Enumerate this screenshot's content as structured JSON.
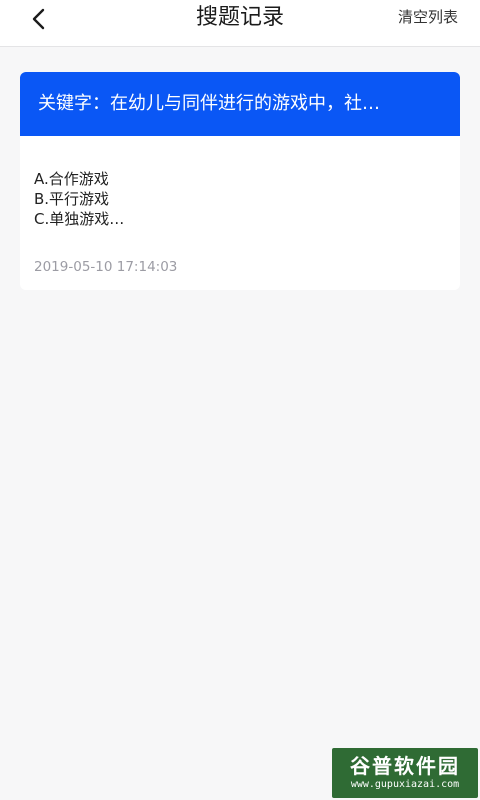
{
  "header": {
    "back_icon": "chevron-left-icon",
    "title": "搜题记录",
    "clear_label": "清空列表"
  },
  "records": [
    {
      "keyword": "关键字：在幼儿与同伴进行的游戏中，社…",
      "options": [
        "A.合作游戏",
        "B.平行游戏",
        "C.单独游戏…"
      ],
      "time": "2019-05-10 17:14:03"
    }
  ],
  "watermark": {
    "logo_text": "谷普软件园",
    "url": "www.gupuxiazai.com"
  },
  "colors": {
    "accent": "#0a57f5",
    "background": "#f7f7f8",
    "timestamp": "#9c9ca4",
    "watermark_bg": "#2f6b34"
  }
}
